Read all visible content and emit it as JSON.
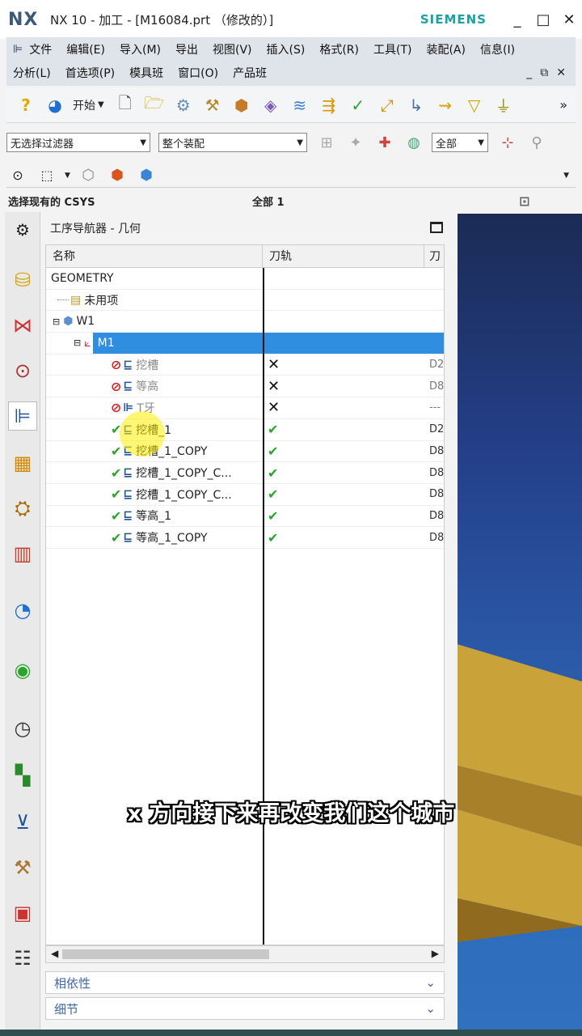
{
  "window": {
    "logo": "NX",
    "title": "NX 10 - 加工 - [M16084.prt （修改的）]",
    "brand": "SIEMENS",
    "controls": [
      "_",
      "□",
      "✕"
    ]
  },
  "menu": {
    "row1": [
      "文件",
      "编辑(E)",
      "导入(M)",
      "导出",
      "视图(V)",
      "插入(S)",
      "格式(R)",
      "工具(T)",
      "装配(A)",
      "信息(I)"
    ],
    "row2": [
      "分析(L)",
      "首选项(P)",
      "模具班",
      "窗口(O)",
      "产品班"
    ]
  },
  "toolbar": {
    "start_label": "开始",
    "overflow": "»"
  },
  "filters": {
    "type_filter": "无选择过滤器",
    "scope_filter": "整个装配",
    "snap_filter": "全部"
  },
  "cue": {
    "left": "选择现有的 CSYS",
    "center": "全部 1"
  },
  "navigator": {
    "title": "工序导航器 - 几何",
    "columns": {
      "name": "名称",
      "path": "刀轨",
      "tool": "刀"
    },
    "rows": [
      {
        "name": "GEOMETRY",
        "path": "",
        "tool": ""
      },
      {
        "name": "未用项",
        "path": "",
        "tool": ""
      },
      {
        "name": "W1",
        "path": "",
        "tool": ""
      },
      {
        "name": "M1",
        "path": "",
        "tool": ""
      },
      {
        "name": "挖槽",
        "path": "✕",
        "tool": "D2"
      },
      {
        "name": "等高",
        "path": "✕",
        "tool": "D8"
      },
      {
        "name": "T牙",
        "path": "✕",
        "tool": "---"
      },
      {
        "name": "挖槽_1",
        "path": "✔",
        "tool": "D2"
      },
      {
        "name": "挖槽_1_COPY",
        "path": "✔",
        "tool": "D8"
      },
      {
        "name": "挖槽_1_COPY_C...",
        "path": "✔",
        "tool": "D8"
      },
      {
        "name": "挖槽_1_COPY_C...",
        "path": "✔",
        "tool": "D8"
      },
      {
        "name": "等高_1",
        "path": "✔",
        "tool": "D8"
      },
      {
        "name": "等高_1_COPY",
        "path": "✔",
        "tool": "D8"
      }
    ],
    "panels": {
      "dependencies": "相依性",
      "details": "细节"
    }
  },
  "subtitle": "x 方向接下来再改变我们这个城市"
}
